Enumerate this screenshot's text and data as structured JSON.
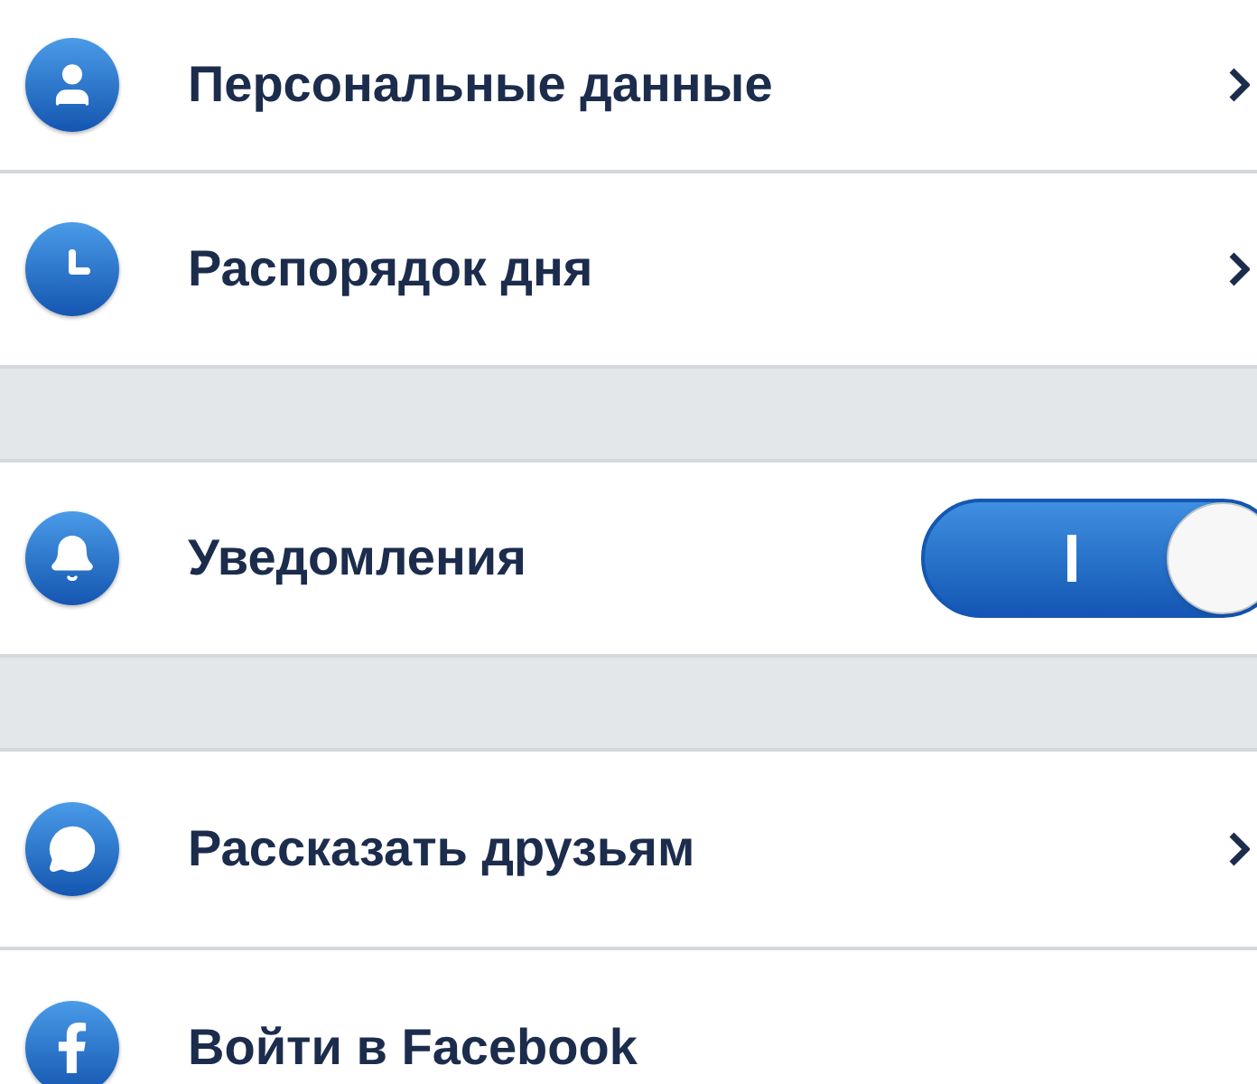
{
  "sections": [
    {
      "items": [
        {
          "kind": "link",
          "label": "Персональные данные"
        },
        {
          "kind": "link",
          "label": "Распорядок дня"
        }
      ]
    },
    {
      "items": [
        {
          "kind": "toggle",
          "label": "Уведомления",
          "on": true
        }
      ]
    },
    {
      "items": [
        {
          "kind": "link",
          "label": "Рассказать друзьям"
        },
        {
          "kind": "plain",
          "label": "Войти в Facebook"
        }
      ]
    }
  ]
}
